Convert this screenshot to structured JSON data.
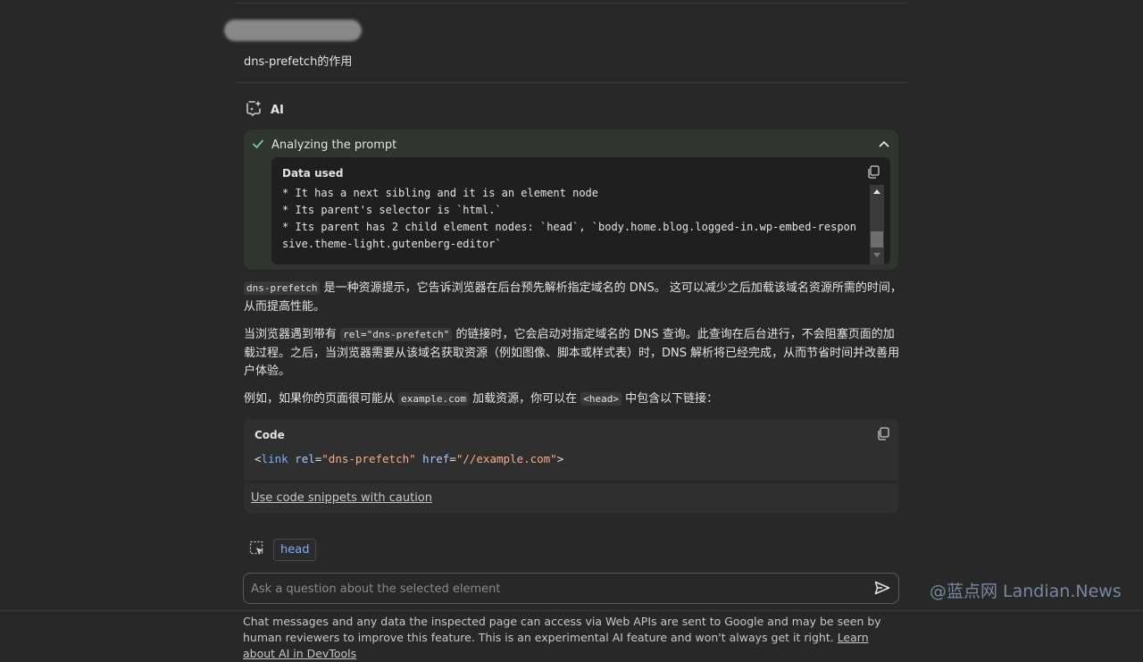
{
  "user_message": {
    "text": "dns-prefetch的作用"
  },
  "ai_header": {
    "label": "AI"
  },
  "step": {
    "title": "Analyzing the prompt",
    "data_used_title": "Data used",
    "data_lines": "* It has a next sibling and it is an element node\n* Its parent's selector is `html.`\n* Its parent has 2 child element nodes: `head`, `body.home.blog.logged-in.wp-embed-responsive.theme-light.gutenberg-editor`"
  },
  "answer": {
    "p1_code": "dns-prefetch",
    "p1_text": " 是一种资源提示，它告诉浏览器在后台预先解析指定域名的 DNS。 这可以减少之后加载该域名资源所需的时间，从而提高性能。",
    "p2_pre": "当浏览器遇到带有 ",
    "p2_code": "rel=\"dns-prefetch\"",
    "p2_post": " 的链接时，它会启动对指定域名的 DNS 查询。此查询在后台进行，不会阻塞页面的加载过程。之后，当浏览器需要从该域名获取资源（例如图像、脚本或样式表）时，DNS 解析将已经完成，从而节省时间并改善用户体验。",
    "p3_pre": "例如，如果你的页面很可能从 ",
    "p3_code1": "example.com",
    "p3_mid": " 加载资源，你可以在 ",
    "p3_code2": "<head>",
    "p3_post": " 中包含以下链接："
  },
  "code_block": {
    "title": "Code",
    "tokens": {
      "open": "<",
      "tag": "link",
      "attr1": "rel",
      "eq1": "=",
      "val1": "\"dns-prefetch\"",
      "attr2": "href",
      "eq2": "=",
      "val2": "\"//example.com\"",
      "close": ">"
    },
    "caution_link": "Use code snippets with caution"
  },
  "context": {
    "chip": "head"
  },
  "input": {
    "placeholder": "Ask a question about the selected element"
  },
  "watermark": "@蓝点网 Landian.News",
  "footer": {
    "text": "Chat messages and any data the inspected page can access via Web APIs are sent to Google and may be seen by human reviewers to improve this feature. This is an experimental AI feature and won't always get it right. ",
    "link": "Learn about AI in DevTools"
  },
  "colors": {
    "background": "#282828",
    "accent_blue": "#7cacf8",
    "check_green": "#6dd58c",
    "string_orange": "#f9ab83"
  },
  "icons": {
    "ai": "ai-sparkle-icon",
    "check": "check-icon",
    "chevron": "chevron-up-icon",
    "copy": "copy-icon",
    "select_element": "select-element-icon",
    "send": "send-icon"
  }
}
